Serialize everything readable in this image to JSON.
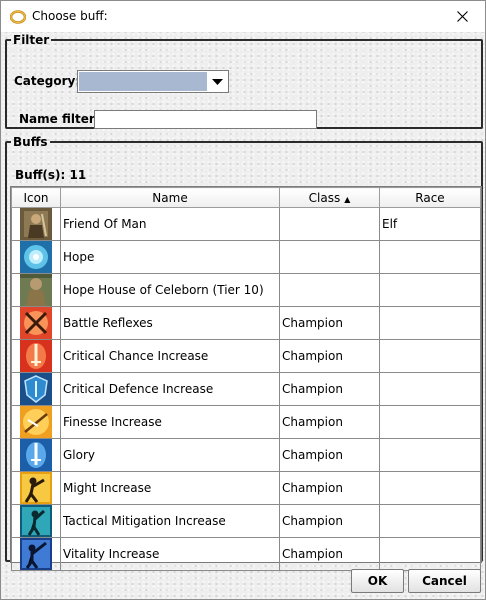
{
  "window": {
    "title": "Choose buff:"
  },
  "filter": {
    "legend": "Filter",
    "category_label": "Category:",
    "category_value": "",
    "name_filter_label": "Name filter:",
    "name_filter_value": "",
    "name_filter_placeholder": ""
  },
  "buffs": {
    "legend": "Buffs",
    "count_label": "Buff(s): 11",
    "columns": {
      "icon": "Icon",
      "name": "Name",
      "class": "Class",
      "race": "Race"
    },
    "sort": {
      "column": "class",
      "direction": "ascending"
    },
    "rows": [
      {
        "icon": "friend-of-man-icon",
        "name": "Friend Of Man",
        "class": "",
        "race": "Elf"
      },
      {
        "icon": "hope-icon",
        "name": "Hope",
        "class": "",
        "race": ""
      },
      {
        "icon": "hope-house-icon",
        "name": "Hope House of Celeborn (Tier 10)",
        "class": "",
        "race": ""
      },
      {
        "icon": "battle-reflexes-icon",
        "name": "Battle Reflexes",
        "class": "Champion",
        "race": ""
      },
      {
        "icon": "critical-chance-icon",
        "name": "Critical Chance Increase",
        "class": "Champion",
        "race": ""
      },
      {
        "icon": "critical-defence-icon",
        "name": "Critical Defence Increase",
        "class": "Champion",
        "race": ""
      },
      {
        "icon": "finesse-icon",
        "name": "Finesse Increase",
        "class": "Champion",
        "race": ""
      },
      {
        "icon": "glory-icon",
        "name": "Glory",
        "class": "Champion",
        "race": ""
      },
      {
        "icon": "might-icon",
        "name": "Might Increase",
        "class": "Champion",
        "race": ""
      },
      {
        "icon": "tactical-mitigation-icon",
        "name": "Tactical Mitigation Increase",
        "class": "Champion",
        "race": ""
      },
      {
        "icon": "vitality-icon",
        "name": "Vitality Increase",
        "class": "Champion",
        "race": ""
      }
    ]
  },
  "buttons": {
    "ok": "OK",
    "cancel": "Cancel"
  },
  "colors": {
    "panel_bg": "#eeeeee",
    "combo_selection": "#a8b8d0",
    "group_border": "#2b2b2b"
  }
}
